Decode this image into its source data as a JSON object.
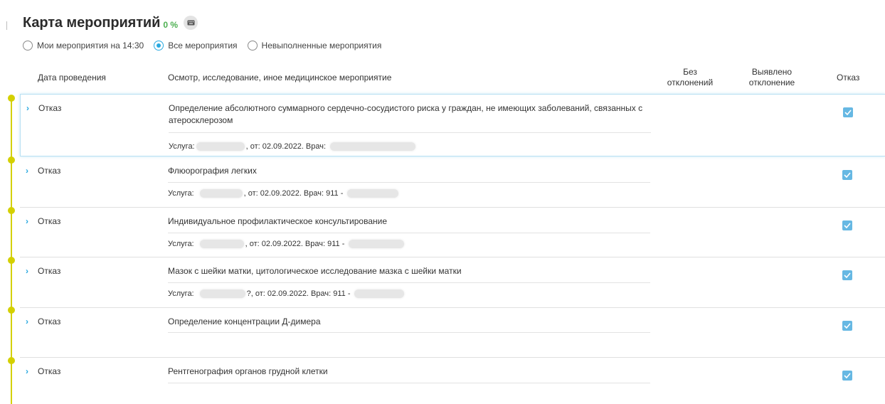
{
  "header": {
    "title": "Карта мероприятий",
    "percent": "0 %",
    "keyboard_icon": "keyboard-icon"
  },
  "filters": [
    {
      "label": "Мои мероприятия на 14:30",
      "selected": false
    },
    {
      "label": "Все мероприятия",
      "selected": true
    },
    {
      "label": "Невыполненные мероприятия",
      "selected": false
    }
  ],
  "columns": {
    "date": "Дата проведения",
    "event": "Осмотр, исследование, иное медицинское мероприятие",
    "no_dev_line1": "Без",
    "no_dev_line2": "отклонений",
    "dev_line1": "Выявлено",
    "dev_line2": "отклонение",
    "refuse": "Отказ"
  },
  "rows": [
    {
      "status": "Отказ",
      "name": "Определение абсолютного суммарного сердечно-сосудистого риска у граждан, не имеющих заболеваний, связанных с атеросклерозом",
      "meta_prefix": "Услуга:",
      "meta_mid": ", от: 02.09.2022. Врач:",
      "meta_suffix": "",
      "refused": true
    },
    {
      "status": "Отказ",
      "name": "Флюорография легких",
      "meta_prefix": "Услуга:",
      "meta_mid": ", от: 02.09.2022. Врач: 911 -",
      "meta_suffix": "",
      "refused": true
    },
    {
      "status": "Отказ",
      "name": "Индивидуальное профилактическое консультирование",
      "meta_prefix": "Услуга:",
      "meta_mid": ", от: 02.09.2022. Врач: 911 -",
      "meta_suffix": "",
      "refused": true
    },
    {
      "status": "Отказ",
      "name": "Мазок с шейки матки, цитологическое исследование мазка с шейки матки",
      "meta_prefix": "Услуга:",
      "meta_mid": "?, от: 02.09.2022. Врач: 911 -",
      "meta_suffix": "",
      "refused": true
    },
    {
      "status": "Отказ",
      "name": "Определение концентрации Д-димера",
      "meta_prefix": "",
      "meta_mid": "",
      "meta_suffix": "",
      "refused": true
    },
    {
      "status": "Отказ",
      "name": "Рентгенография органов грудной клетки",
      "meta_prefix": "",
      "meta_mid": "",
      "meta_suffix": "",
      "refused": true
    }
  ],
  "colors": {
    "accent": "#29a9e0",
    "timeline": "#d4d000",
    "percent": "#4caf50",
    "checkbox": "#66b8e3"
  }
}
